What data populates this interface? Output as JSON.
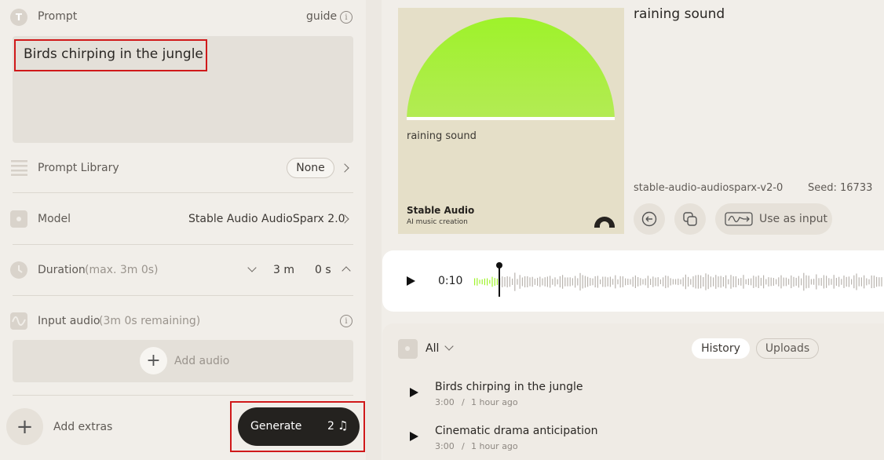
{
  "prompt": {
    "icon": "T",
    "label": "Prompt",
    "guide_label": "guide",
    "value": "Birds chirping in the jungle"
  },
  "prompt_library": {
    "label": "Prompt Library",
    "value": "None"
  },
  "model": {
    "label": "Model",
    "value": "Stable Audio AudioSparx 2.0"
  },
  "duration": {
    "label": "Duration",
    "hint": "(max. 3m 0s)",
    "minutes": "3 m",
    "seconds": "0 s"
  },
  "input_audio": {
    "label": "Input audio",
    "hint": "(3m 0s remaining)",
    "add_label": "Add audio"
  },
  "extras": {
    "label": "Add extras"
  },
  "generate": {
    "label": "Generate",
    "count": "2"
  },
  "cover": {
    "title": "raining sound",
    "brand": "Stable Audio",
    "tagline": "AI music creation"
  },
  "track": {
    "title": "raining sound",
    "model_id": "stable-audio-audiosparx-v2-0",
    "seed": "Seed: 16733",
    "use_as_input_label": "Use as input"
  },
  "player": {
    "time": "0:10",
    "progress": 0.06
  },
  "history": {
    "filter_label": "All",
    "tabs": [
      "History",
      "Uploads"
    ],
    "active_tab": "History",
    "items": [
      {
        "title": "Birds chirping in the jungle",
        "duration": "3:00",
        "sep": "/",
        "ago": "1 hour ago"
      },
      {
        "title": "Cinematic drama anticipation",
        "duration": "3:00",
        "sep": "/",
        "ago": "1 hour ago"
      }
    ]
  },
  "colors": {
    "accent_green": "#9ef22a",
    "highlight_red": "#d0191a",
    "generate_bg": "#24221f"
  }
}
